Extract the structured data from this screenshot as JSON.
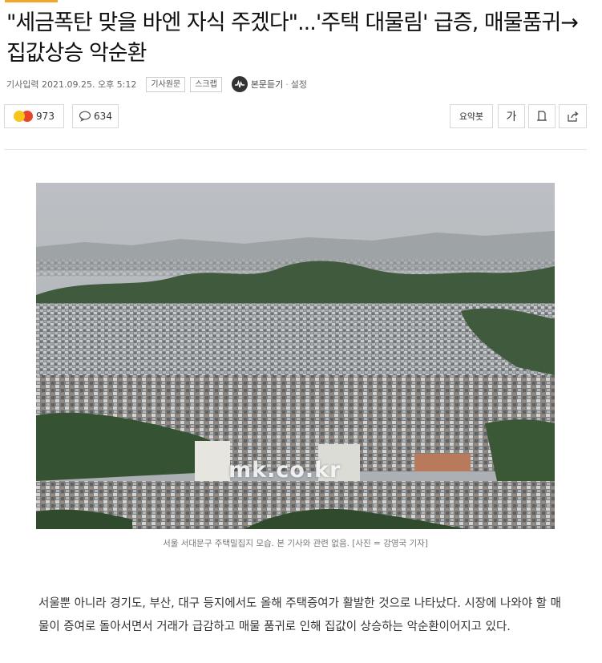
{
  "article": {
    "title": "\"세금폭탄 맞을 바엔 자식 주겠다\"...'주택 대물림' 급증, 매물품귀→집값상승 악순환",
    "meta": {
      "date": "기사입력 2021.09.25. 오후 5:12",
      "original_label": "기사원문",
      "scrap_label": "스크랩",
      "listen_label": "본문듣기",
      "separator": "·",
      "settings_label": "설정"
    },
    "actions": {
      "reactions_count": "973",
      "comments_count": "634",
      "summary_label": "요약봇",
      "font_label": "가"
    },
    "photo": {
      "watermark": "mk.co.kr",
      "caption": "서울 서대문구 주택밀집지 모습. 본 기사와 관련 없음. [사진 = 강영국 기자]"
    },
    "body": "서울뿐 아니라 경기도, 부산, 대구 등지에서도 올해 주택증여가 활발한 것으로 나타났다. 시장에 나와야 할 매물이 증여로 돌아서면서 거래가 급감하고 매물 품귀로 인해 집값이 상승하는 악순환이어지고 있다."
  },
  "icons": {
    "reaction_emojis": [
      "smile-emoji-icon",
      "angry-emoji-icon"
    ],
    "comment": "speech-bubble-icon",
    "listen": "audio-wave-icon",
    "print": "print-icon",
    "share": "share-icon"
  },
  "colors": {
    "accent": "#f2a72b",
    "text": "#222222",
    "muted": "#777777",
    "border": "#d8d8d8"
  }
}
